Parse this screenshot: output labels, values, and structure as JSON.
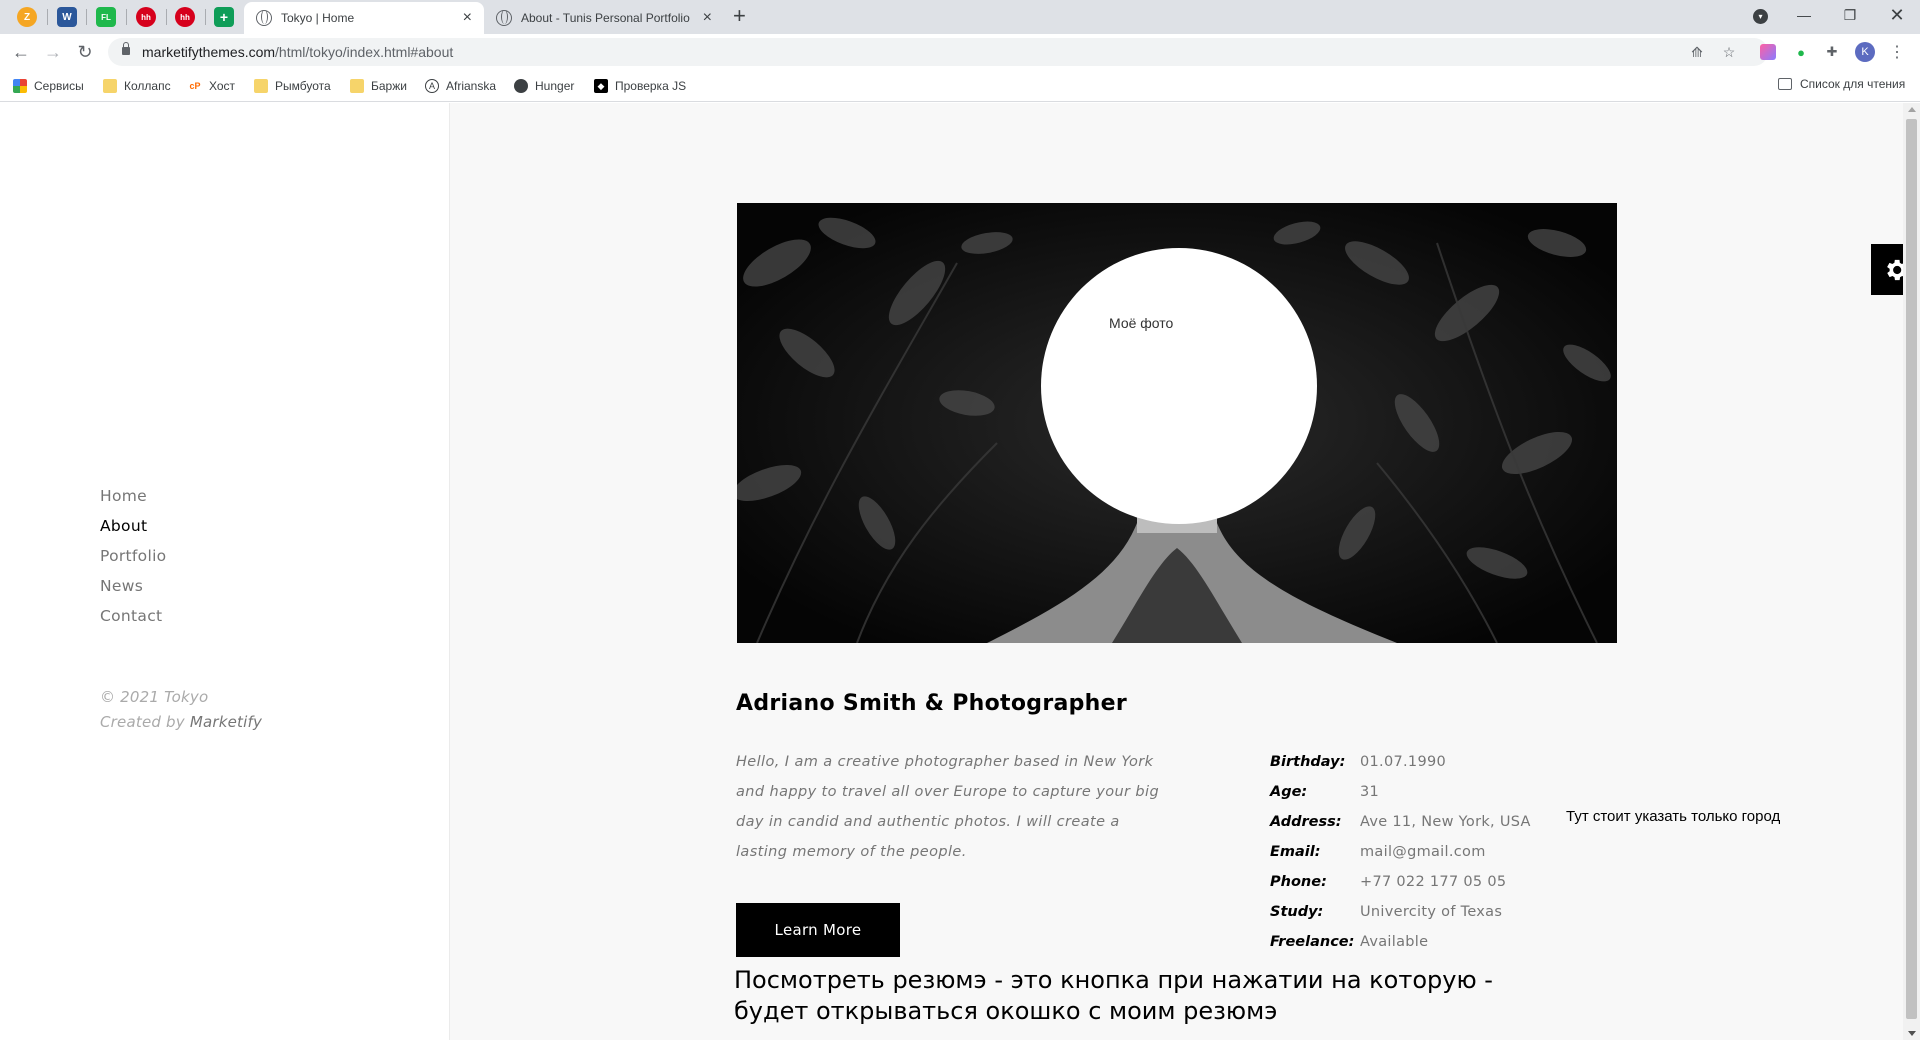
{
  "browser": {
    "pinned_tabs": [
      {
        "icon": "cyrillic-z-icon",
        "color": "#f5a623",
        "glyph": "Z"
      },
      {
        "icon": "word-icon",
        "color": "#2b579a",
        "glyph": "W"
      },
      {
        "icon": "fl-icon",
        "color": "#1fb84c",
        "glyph": "FL"
      },
      {
        "icon": "hh-icon",
        "color": "#d6001c",
        "glyph": "hh"
      },
      {
        "icon": "hh-icon",
        "color": "#d6001c",
        "glyph": "hh"
      },
      {
        "icon": "sheets-icon",
        "color": "#0f9d58",
        "glyph": "+"
      }
    ],
    "tabs": [
      {
        "title": "Tokyo | Home",
        "active": true
      },
      {
        "title": "About - Tunis Personal Portfolio",
        "active": false
      }
    ],
    "url_host": "marketifythemes.com",
    "url_path": "/html/tokyo/index.html#about",
    "profile_initial": "K",
    "bookmarks": [
      {
        "label": "Сервисы",
        "icon": "apps-grid-icon"
      },
      {
        "label": "Коллапс",
        "icon": "folder-icon"
      },
      {
        "label": "Хост",
        "icon": "host-icon"
      },
      {
        "label": "Рымбуота",
        "icon": "folder-icon"
      },
      {
        "label": "Баржи",
        "icon": "folder-icon"
      },
      {
        "label": "Afrianska",
        "icon": "circle-a-icon"
      },
      {
        "label": "Hunger",
        "icon": "globe-icon"
      },
      {
        "label": "Проверка JS",
        "icon": "cube-icon"
      }
    ],
    "reading_list": "Список для чтения"
  },
  "sidebar": {
    "menu": [
      "Home",
      "About",
      "Portfolio",
      "News",
      "Contact"
    ],
    "active_index": 1,
    "copyright": "© 2021 Tokyo",
    "created_by": "Created by",
    "brand": "Marketify"
  },
  "about": {
    "photo_label": "Моё фото",
    "heading": "Adriano Smith & Photographer",
    "bio": "Hello, I am a creative photographer based in New York and happy to travel all over Europe to capture your big day in candid and authentic photos. I will create a lasting memory of the people.",
    "button": "Learn More",
    "info": [
      {
        "k": "Birthday:",
        "v": "01.07.1990"
      },
      {
        "k": "Age:",
        "v": "31"
      },
      {
        "k": "Address:",
        "v": "Ave 11, New York, USA"
      },
      {
        "k": "Email:",
        "v": "mail@gmail.com"
      },
      {
        "k": "Phone:",
        "v": "+77 022 177 05 05"
      },
      {
        "k": "Study:",
        "v": "Univercity of Texas"
      },
      {
        "k": "Freelance:",
        "v": "Available"
      }
    ],
    "note_city": "Тут стоит указать только город",
    "note_resume": "Посмотреть резюмэ  - это кнопка при нажатии на которую - будет открываться окошко с моим резюмэ"
  },
  "colors": {
    "accent": "#000000",
    "muted": "#767676",
    "page_bg": "#f8f8f8"
  }
}
